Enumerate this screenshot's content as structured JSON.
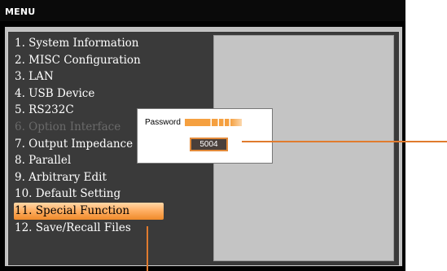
{
  "window": {
    "title": "MENU"
  },
  "menu": {
    "items": [
      {
        "label": "1. System Information",
        "state": "normal"
      },
      {
        "label": "2. MISC Configuration",
        "state": "normal"
      },
      {
        "label": "3. LAN",
        "state": "normal"
      },
      {
        "label": "4. USB Device",
        "state": "normal"
      },
      {
        "label": "5. RS232C",
        "state": "normal"
      },
      {
        "label": "6. Option Interface",
        "state": "disabled"
      },
      {
        "label": "7. Output Impedance",
        "state": "normal"
      },
      {
        "label": "8. Parallel",
        "state": "normal"
      },
      {
        "label": "9. Arbitrary Edit",
        "state": "normal"
      },
      {
        "label": "10. Default Setting",
        "state": "normal"
      },
      {
        "label": "11. Special Function",
        "state": "selected"
      },
      {
        "label": "12. Save/Recall Files",
        "state": "normal"
      }
    ]
  },
  "password_dialog": {
    "label": "Password",
    "value": "5004"
  },
  "colors": {
    "accent": "#f5a040",
    "callout": "#e07b2e",
    "panel": "#c4c4c4",
    "background": "#000000"
  }
}
